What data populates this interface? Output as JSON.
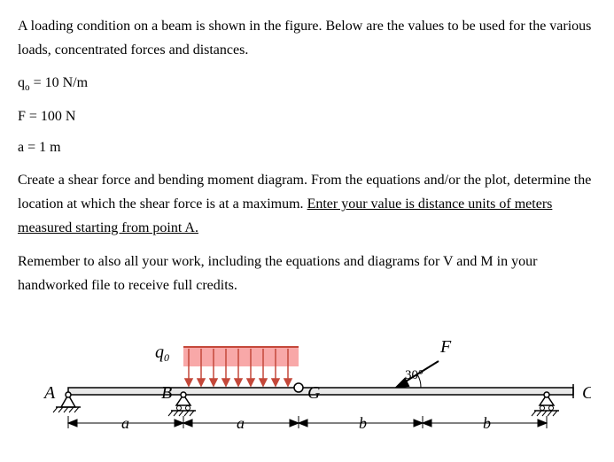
{
  "intro": "A loading condition on a beam is shown in the figure. Below are the values to be used for the various loads, concentrated forces and distances.",
  "params": {
    "q0": "q",
    "q0sub": "o",
    "q0val": " = 10 N/m",
    "F": "F = 100 N",
    "a": "a = 1 m"
  },
  "instr1": "Create a shear force and bending moment diagram. From the equations and/or the plot, determine the location at which the shear force is at a maximum. ",
  "instr_underline": "Enter your value is distance units of meters measured starting from point A.",
  "reminder": "Remember to also all your work, including the equations and diagrams for V and M in your handworked file to receive full credits.",
  "labels": {
    "q0": "q",
    "q0sub": "0",
    "F": "F",
    "angle": "30°",
    "A": "A",
    "B": "B",
    "G": "G",
    "C": "C",
    "a1": "a",
    "a2": "a",
    "b1": "b",
    "b2": "b"
  }
}
